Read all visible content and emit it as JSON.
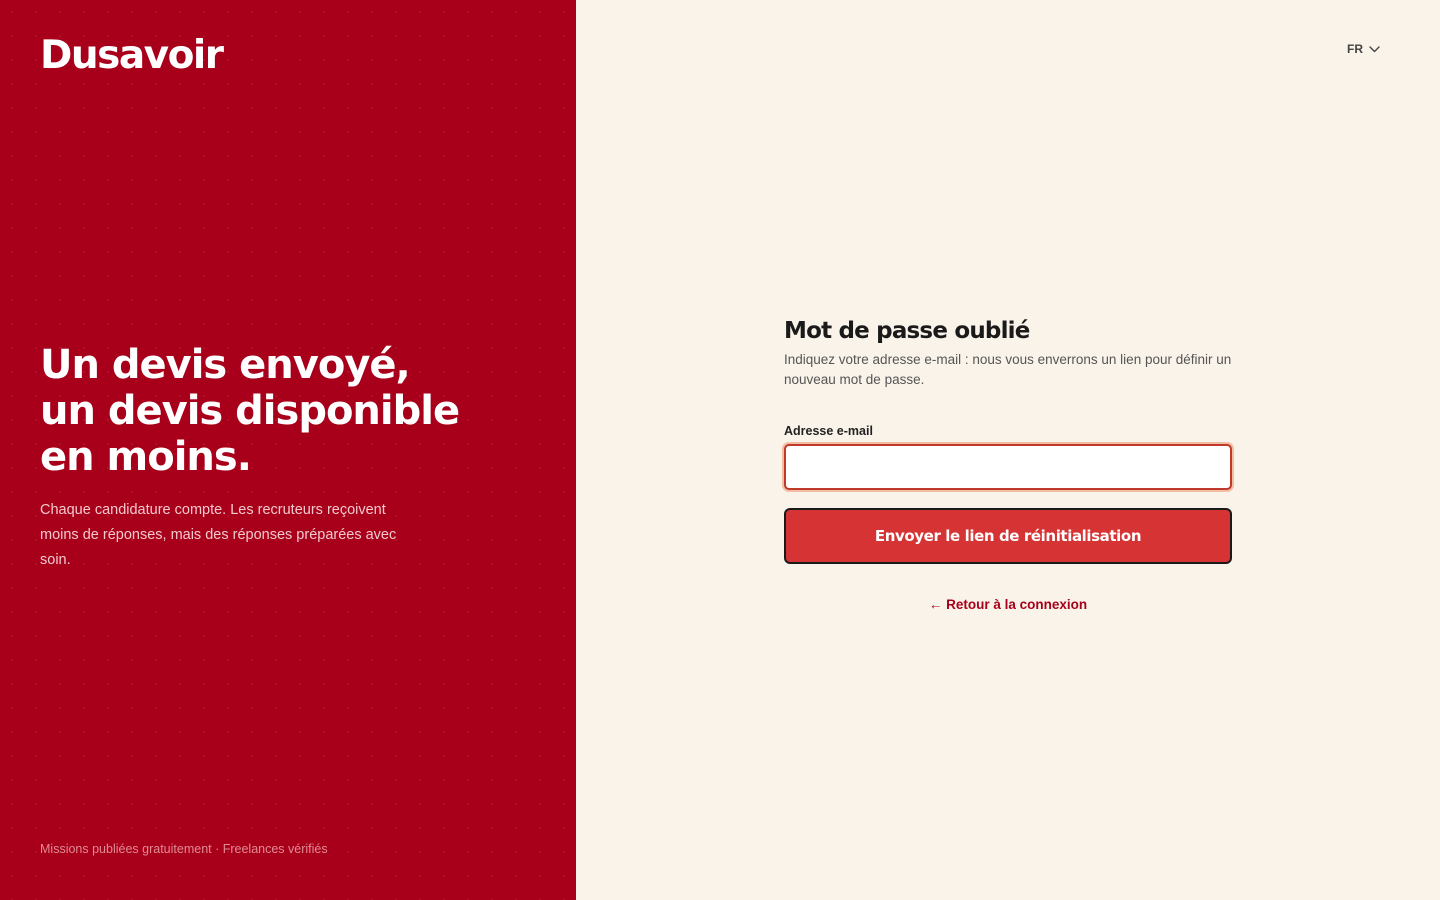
{
  "brand": {
    "name": "Dusavoir",
    "primary_color": "#a8001a",
    "button_color": "#d63334",
    "background_color": "#faf3ea"
  },
  "hero": {
    "title_lines": [
      "Un devis envoyé,",
      "un devis disponible",
      "en moins."
    ],
    "text": "Chaque candidature compte. Les recruteurs reçoivent moins de réponses, mais des réponses préparées avec soin.",
    "footer": "Missions publiées gratuitement · Freelances vérifiés"
  },
  "language": {
    "selected": "FR",
    "icon": "chevron-down-icon"
  },
  "form": {
    "title": "Mot de passe oublié",
    "description": "Indiquez votre adresse e-mail : nous vous enverrons un lien pour définir un nouveau mot de passe.",
    "email_label": "Adresse e-mail",
    "email_value": "",
    "submit_label": "Envoyer le lien de réinitialisation",
    "back_link": "← Retour à la connexion"
  }
}
